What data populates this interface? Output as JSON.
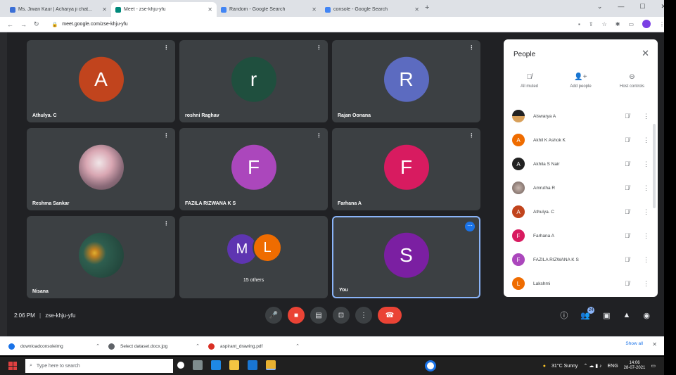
{
  "browser": {
    "tabs": [
      {
        "label": "Ms. Jiwan Kaur | Acharya ji chat...",
        "fav": "#3b6fd6"
      },
      {
        "label": "Meet - zse-khju-yfu",
        "fav": "#00897b"
      },
      {
        "label": "Random - Google Search",
        "fav": "#4285f4"
      },
      {
        "label": "console - Google Search",
        "fav": "#4285f4"
      }
    ],
    "new_tab": "+",
    "url": "meet.google.com/zse-khju-yfu"
  },
  "tiles": [
    {
      "name": "Athulya. C",
      "initial": "A",
      "color": "#c1441d"
    },
    {
      "name": "roshni Raghav",
      "initial": "r",
      "color": "#1f4f3e"
    },
    {
      "name": "Rajan Oonana",
      "initial": "R",
      "color": "#5c6bc0"
    },
    {
      "name": "Reshma Sankar",
      "initial": "",
      "color": "#b0a0a8"
    },
    {
      "name": "FAZILA RIZWANA K S",
      "initial": "F",
      "color": "#ab47bc"
    },
    {
      "name": "Farhana A",
      "initial": "F",
      "color": "#d81b60"
    },
    {
      "name": "Nisana",
      "initial": "",
      "color": "#2e5e4f"
    },
    {
      "name": "15 others",
      "initial": "",
      "color": ""
    },
    {
      "name": "You",
      "initial": "S",
      "color": "#7b1fa2"
    }
  ],
  "others_avatars": [
    {
      "initial": "M",
      "color": "#5e35b1"
    },
    {
      "initial": "L",
      "color": "#ef6c00"
    }
  ],
  "people_panel": {
    "title": "People",
    "actions": [
      "All muted",
      "Add people",
      "Host controls"
    ],
    "participants": [
      {
        "name": "Aiswarya A",
        "initial": "",
        "color": "#222222"
      },
      {
        "name": "Akhil K Ashok K",
        "initial": "A",
        "color": "#ef6c00"
      },
      {
        "name": "Akhila S Nair",
        "initial": "A",
        "color": "#222222"
      },
      {
        "name": "Amrutha R",
        "initial": "",
        "color": "#8d8d8d"
      },
      {
        "name": "Athulya. C",
        "initial": "A",
        "color": "#c1441d"
      },
      {
        "name": "Farhana A",
        "initial": "F",
        "color": "#d81b60"
      },
      {
        "name": "FAZILA RIZWANA K S",
        "initial": "F",
        "color": "#ab47bc"
      },
      {
        "name": "Lakshmi",
        "initial": "L",
        "color": "#ef6c00"
      }
    ]
  },
  "controls": {
    "time": "2:06 PM",
    "separator": "|",
    "meeting_code": "zse-khju-yfu",
    "people_count": "24"
  },
  "downloads": {
    "items": [
      "downloadconsoleimg",
      "Select dataset.docx.jpg",
      "aspirant_drawing.pdf"
    ],
    "show_all": "Show all"
  },
  "taskbar": {
    "search_placeholder": "Type here to search",
    "weather": "31°C Sunny",
    "lang": "ENG",
    "time": "14:06",
    "date": "28-07-2021"
  }
}
